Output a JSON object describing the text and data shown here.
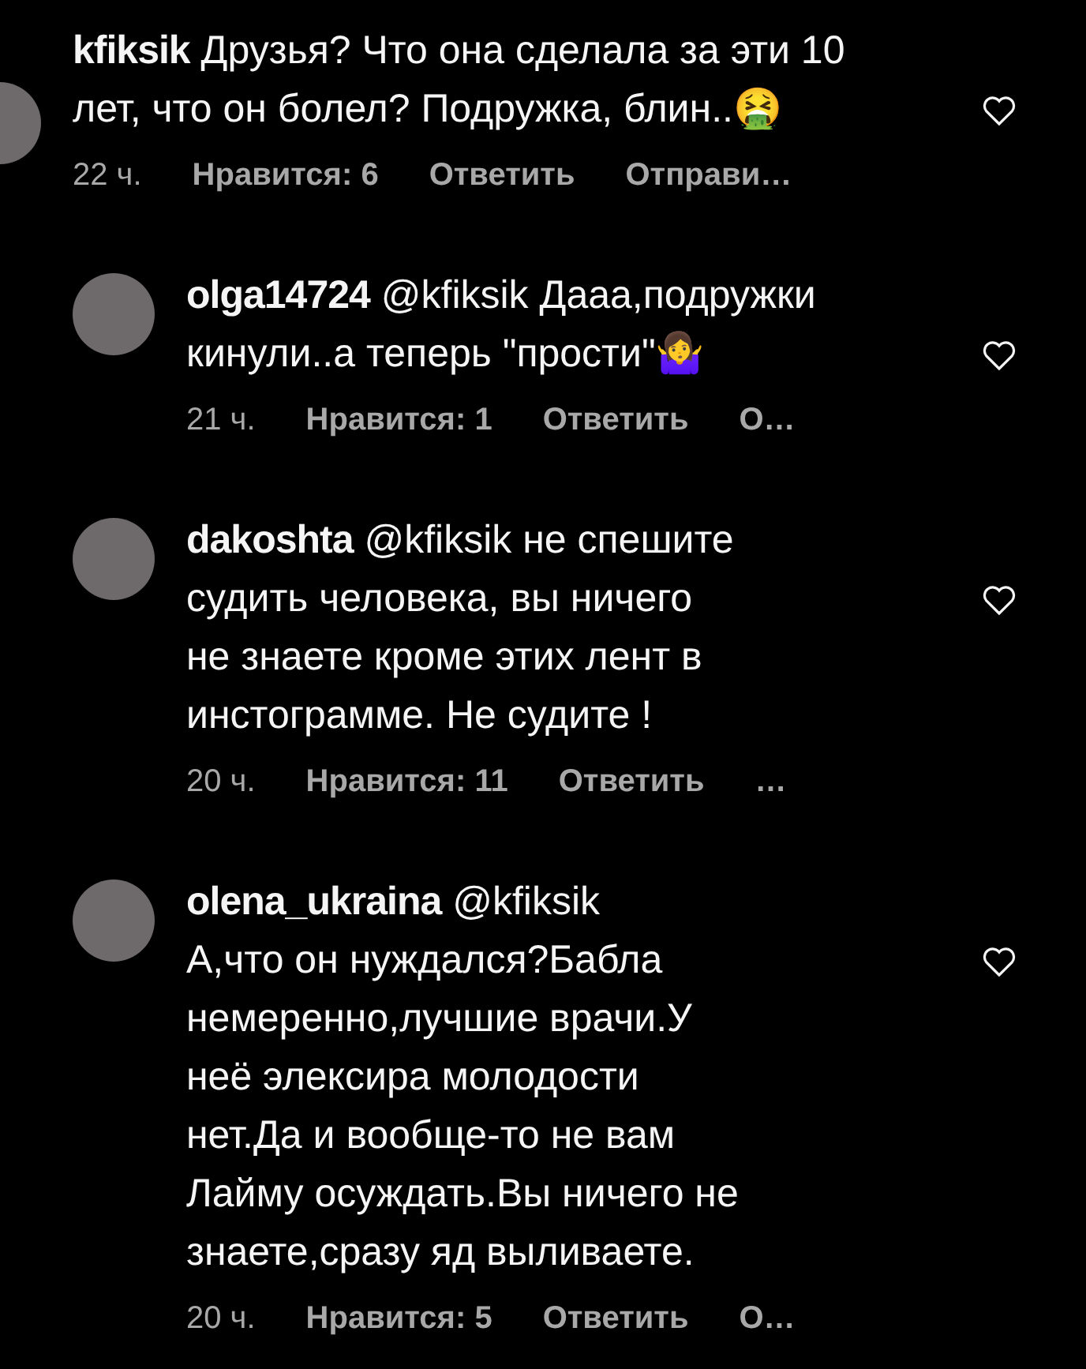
{
  "comments": [
    {
      "kind": "top",
      "username": "kfiksik",
      "lines": [
        "Друзья? Что она сделала за эти 10",
        "лет, что он болел? Подружка, блин..🤮"
      ],
      "liked": false,
      "time": "22 ч.",
      "likes": "Нравится: 6",
      "reply": "Ответить",
      "more": "Отправи…"
    },
    {
      "kind": "reply",
      "username": "olga14724",
      "mention": "@kfiksik",
      "lines": [
        "Дааа,подружки",
        "кинули..а теперь \"прости\"🤷‍♀️"
      ],
      "liked": false,
      "time": "21 ч.",
      "likes": "Нравится: 1",
      "reply": "Ответить",
      "more": "О…"
    },
    {
      "kind": "reply",
      "username": "dakoshta",
      "mention": "@kfiksik",
      "lines": [
        "не спешите",
        "судить человека, вы ничего",
        "не знаете кроме этих лент в",
        "инстограмме. Не судите !"
      ],
      "liked": false,
      "time": "20 ч.",
      "likes": "Нравится: 11",
      "reply": "Ответить",
      "more": "…"
    },
    {
      "kind": "reply",
      "username": "olena_ukraina",
      "mention": "@kfiksik",
      "lines": [
        "А,что он нуждался?Бабла",
        "немеренно,лучшие врачи.У",
        "неё элексира молодости",
        "нет.Да и вообще-то не вам",
        "Лайму осуждать.Вы ничего не",
        "знаете,сразу яд выливаете."
      ],
      "break_after_mention": true,
      "liked": false,
      "time": "20 ч.",
      "likes": "Нравится: 5",
      "reply": "Ответить",
      "more": "О…"
    }
  ]
}
